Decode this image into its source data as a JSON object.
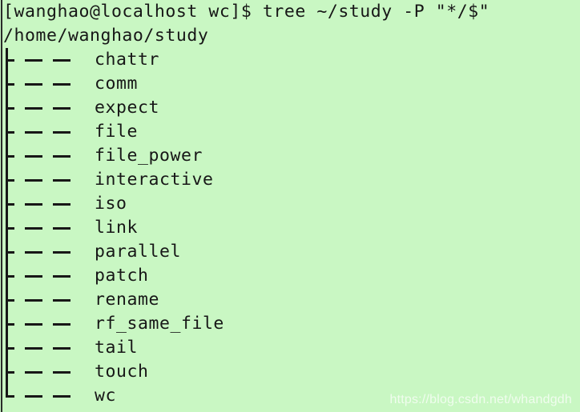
{
  "terminal": {
    "background_color": "#c9f7c3",
    "text_color": "#171717",
    "prompt_line": "[wanghao@localhost wc]$ tree ~/study -P \"*/$\"",
    "root_path": "/home/wanghao/study",
    "tree_prefix_branch": "├──",
    "tree_prefix_last": "└──",
    "entries": [
      {
        "name": "chattr",
        "connector": "├──"
      },
      {
        "name": "comm",
        "connector": "├──"
      },
      {
        "name": "expect",
        "connector": "├──"
      },
      {
        "name": "file",
        "connector": "├──"
      },
      {
        "name": "file_power",
        "connector": "├──"
      },
      {
        "name": "interactive",
        "connector": "├──"
      },
      {
        "name": "iso",
        "connector": "├──"
      },
      {
        "name": "link",
        "connector": "├──"
      },
      {
        "name": "parallel",
        "connector": "├──"
      },
      {
        "name": "patch",
        "connector": "├──"
      },
      {
        "name": "rename",
        "connector": "├──"
      },
      {
        "name": "rf_same_file",
        "connector": "├──"
      },
      {
        "name": "tail",
        "connector": "├──"
      },
      {
        "name": "touch",
        "connector": "├──"
      },
      {
        "name": "wc",
        "connector": "└──"
      }
    ]
  },
  "watermark": {
    "text": "https://blog.csdn.net/whandgdh"
  }
}
